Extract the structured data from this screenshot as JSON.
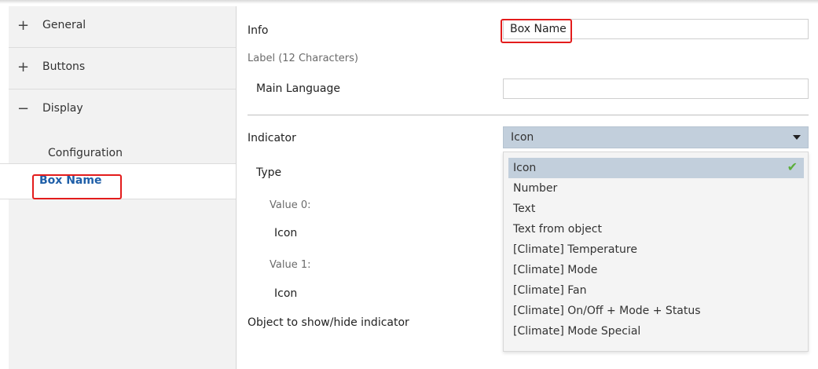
{
  "sidebar": {
    "items": [
      {
        "sign": "+",
        "label": "General"
      },
      {
        "sign": "+",
        "label": "Buttons"
      },
      {
        "sign": "−",
        "label": "Display"
      }
    ],
    "sub_items": [
      {
        "label": "Configuration"
      },
      {
        "label": "Box Name"
      }
    ]
  },
  "main": {
    "info_label": "Info",
    "info_value": "Box Name",
    "label_section": "Label (12 Characters)",
    "main_language_label": "Main Language",
    "main_language_value": "",
    "indicator_label": "Indicator",
    "indicator_value": "Icon",
    "type_label": "Type",
    "value0_label": "Value 0:",
    "value0_value": "Icon",
    "value1_label": "Value 1:",
    "value1_value": "Icon",
    "object_label": "Object to show/hide indicator"
  },
  "dropdown_options": [
    "Icon",
    "Number",
    "Text",
    "Text from object",
    "[Climate] Temperature",
    "[Climate] Mode",
    "[Climate] Fan",
    "[Climate] On/Off + Mode + Status",
    "[Climate] Mode Special"
  ],
  "colors": {
    "accent_blue": "#1f5fa8",
    "highlight_red": "#e31c1c",
    "dropdown_bg": "#c2cfdc",
    "check_green": "#5cae3b"
  },
  "icons": {
    "check": "check-icon",
    "caret": "chevron-down-icon"
  }
}
